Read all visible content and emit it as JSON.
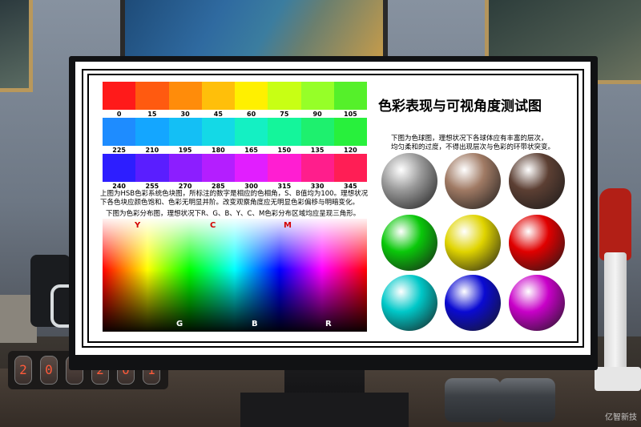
{
  "chart_title": "色彩表现与可视角度测试图",
  "hue_rows": [
    {
      "hues": [
        "#ff1a1a",
        "#ff5a10",
        "#ff8c0a",
        "#ffbf0a",
        "#fff000",
        "#c8ff14",
        "#96ff28",
        "#55f02a"
      ],
      "labels": [
        "0",
        "15",
        "30",
        "45",
        "60",
        "75",
        "90",
        "105"
      ]
    },
    {
      "hues": [
        "#1e8cff",
        "#14a6ff",
        "#14bff5",
        "#14d9e6",
        "#14f0c3",
        "#14f59b",
        "#1ef06e",
        "#28f03c"
      ],
      "labels": [
        "225",
        "210",
        "195",
        "180",
        "165",
        "150",
        "135",
        "120"
      ]
    },
    {
      "hues": [
        "#2d1eff",
        "#5a1eff",
        "#8c1eff",
        "#b41eff",
        "#e11eff",
        "#ff1ed2",
        "#ff1e8c",
        "#ff1e55"
      ],
      "labels": [
        "240",
        "255",
        "270",
        "285",
        "300",
        "315",
        "330",
        "345"
      ]
    }
  ],
  "caption_hsb": [
    "上图为HSB色彩系统色块图，所标注的数字是相应的色相角，S、B值均为100。理想状况",
    "下各色块应颜色饱和、色彩无明显并阶。改变观察角度应无明显色彩偏移与明暗变化。"
  ],
  "caption_gamut": "下图为色彩分布图，理想状况下R、G、B、Y、C、M色彩分布区域均应呈现三角形。",
  "gamut_top_labels": [
    "Y",
    "C",
    "M"
  ],
  "gamut_bottom_labels": [
    "G",
    "B",
    "R"
  ],
  "caption_spheres": [
    "下图为色球图，理想状况下各球体应有丰富的层次，",
    "均匀柔和的过度，不得出现层次与色彩的环带状突变。"
  ],
  "spheres": [
    {
      "name": "gray",
      "color": "#9a9a9a"
    },
    {
      "name": "tan",
      "color": "#a07a64"
    },
    {
      "name": "brown",
      "color": "#5c3f33"
    },
    {
      "name": "green",
      "color": "#0ac80a"
    },
    {
      "name": "yellow",
      "color": "#e0d400"
    },
    {
      "name": "red",
      "color": "#e00000"
    },
    {
      "name": "cyan",
      "color": "#00c8c8"
    },
    {
      "name": "blue",
      "color": "#0a0ad2"
    },
    {
      "name": "magenta",
      "color": "#c800c8"
    }
  ],
  "nixie_digits": [
    "2",
    "0",
    "",
    "2",
    "0",
    "1"
  ],
  "watermark": "亿智新技"
}
